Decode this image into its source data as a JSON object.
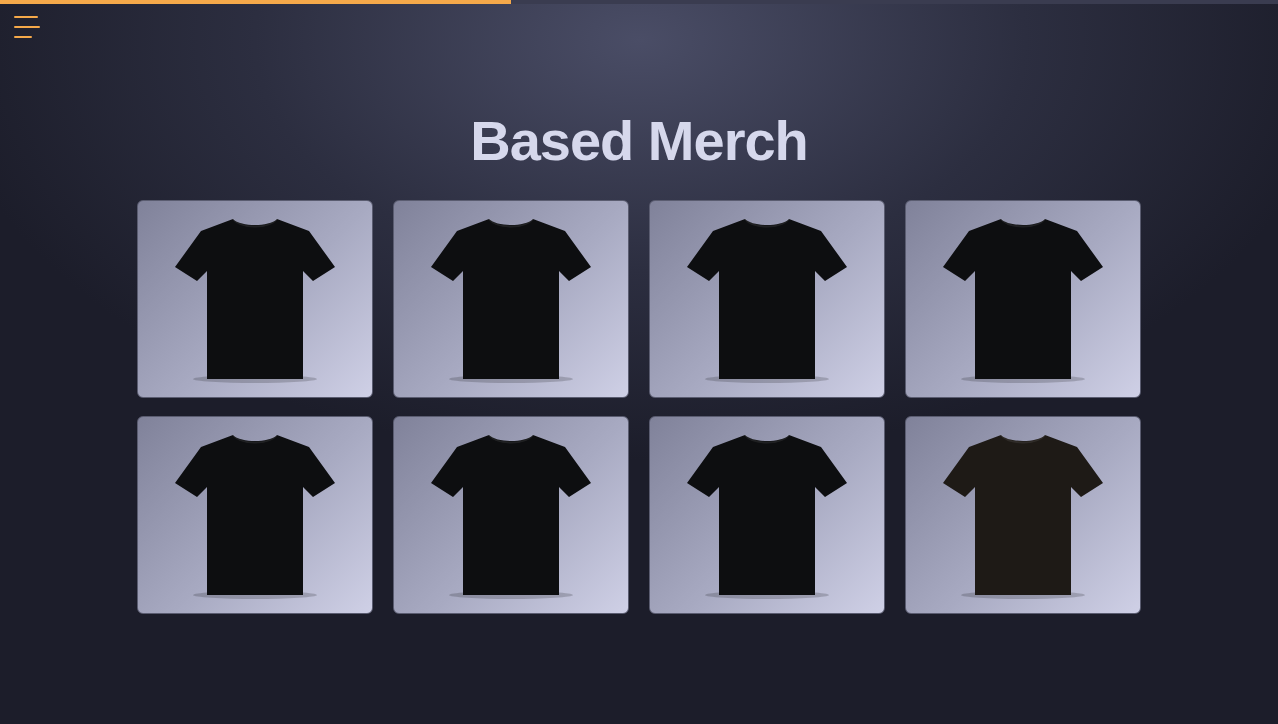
{
  "progress": {
    "level": 0.4
  },
  "title": "Based Merch",
  "products": [
    {
      "color": "#0d0e10"
    },
    {
      "color": "#0d0e10"
    },
    {
      "color": "#0d0e10"
    },
    {
      "color": "#0d0e10"
    },
    {
      "color": "#0d0e10"
    },
    {
      "color": "#0d0e10"
    },
    {
      "color": "#0d0e10"
    },
    {
      "color": "#1e1a16"
    }
  ]
}
